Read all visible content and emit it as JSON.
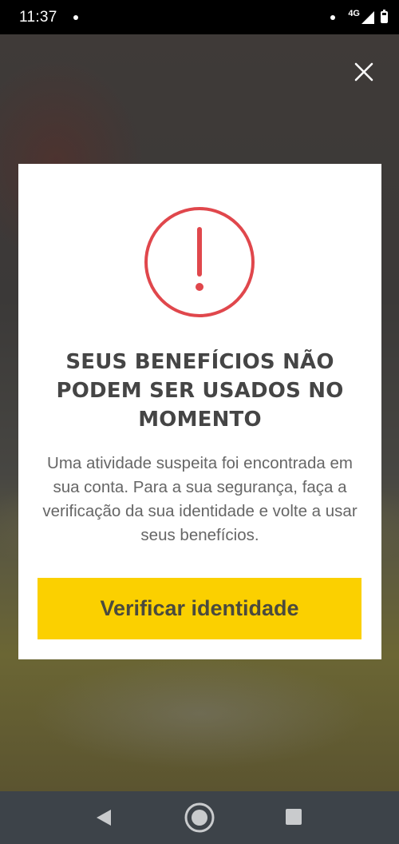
{
  "status_bar": {
    "time": "11:37",
    "network": "4G"
  },
  "modal": {
    "title": "SEUS BENEFÍCIOS NÃO PODEM SER USADOS NO MOMENTO",
    "body": "Uma atividade suspeita foi encontrada em sua conta. Para a sua segurança, faça a verificação da sua identidade e volte a usar seus benefícios.",
    "primary_button_label": "Verificar identidade",
    "icon": "exclamation-circle-icon"
  },
  "colors": {
    "accent_yellow": "#fbd000",
    "alert_red": "#e0474c",
    "title_text": "#454545",
    "body_text": "#666666",
    "nav_bar": "#3d4349"
  },
  "icons": {
    "close": "close-icon",
    "back": "back-triangle-icon",
    "home": "home-circle-icon",
    "recents": "recents-square-icon"
  }
}
